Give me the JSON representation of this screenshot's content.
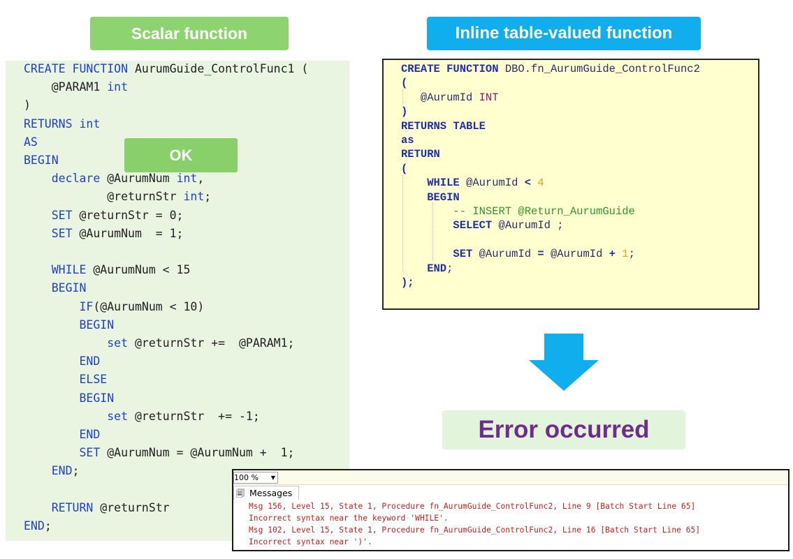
{
  "titles": {
    "scalar": "Scalar function",
    "itvf": "Inline table-valued function",
    "ok": "OK",
    "error": "Error occurred"
  },
  "scalar_code": [
    [
      {
        "t": "CREATE FUNCTION ",
        "c": "kw"
      },
      {
        "t": "AurumGuide_ControlFunc1 (",
        "c": ""
      }
    ],
    [
      {
        "t": "    @PARAM1 ",
        "c": ""
      },
      {
        "t": "int",
        "c": "ty"
      }
    ],
    [
      {
        "t": ")",
        "c": ""
      }
    ],
    [
      {
        "t": "RETURNS ",
        "c": "kw"
      },
      {
        "t": "int",
        "c": "ty"
      }
    ],
    [
      {
        "t": "AS",
        "c": "kw"
      }
    ],
    [
      {
        "t": "BEGIN",
        "c": "kw"
      }
    ],
    [
      {
        "t": "    declare ",
        "c": "kw"
      },
      {
        "t": "@AurumNum ",
        "c": ""
      },
      {
        "t": "int",
        "c": "ty"
      },
      {
        "t": ",",
        "c": ""
      }
    ],
    [
      {
        "t": "            @returnStr ",
        "c": ""
      },
      {
        "t": "int",
        "c": "ty"
      },
      {
        "t": ";",
        "c": ""
      }
    ],
    [
      {
        "t": "    SET ",
        "c": "kw"
      },
      {
        "t": "@returnStr = 0;",
        "c": ""
      }
    ],
    [
      {
        "t": "    SET ",
        "c": "kw"
      },
      {
        "t": "@AurumNum  = 1;",
        "c": ""
      }
    ],
    [
      {
        "t": "",
        "c": ""
      }
    ],
    [
      {
        "t": "    WHILE ",
        "c": "kw"
      },
      {
        "t": "@AurumNum < 15",
        "c": ""
      }
    ],
    [
      {
        "t": "    BEGIN",
        "c": "kw"
      }
    ],
    [
      {
        "t": "        IF",
        "c": "kw"
      },
      {
        "t": "(@AurumNum < 10)",
        "c": ""
      }
    ],
    [
      {
        "t": "        BEGIN",
        "c": "kw"
      }
    ],
    [
      {
        "t": "            set ",
        "c": "kw"
      },
      {
        "t": "@returnStr +=  @PARAM1;",
        "c": ""
      }
    ],
    [
      {
        "t": "        END",
        "c": "kw"
      }
    ],
    [
      {
        "t": "        ELSE",
        "c": "kw"
      }
    ],
    [
      {
        "t": "        BEGIN",
        "c": "kw"
      }
    ],
    [
      {
        "t": "            set ",
        "c": "kw"
      },
      {
        "t": "@returnStr  += -1;",
        "c": ""
      }
    ],
    [
      {
        "t": "        END",
        "c": "kw"
      }
    ],
    [
      {
        "t": "        SET ",
        "c": "kw"
      },
      {
        "t": "@AurumNum = @AurumNum +  1;",
        "c": ""
      }
    ],
    [
      {
        "t": "    END",
        "c": "kw"
      },
      {
        "t": ";",
        "c": ""
      }
    ],
    [
      {
        "t": "",
        "c": ""
      }
    ],
    [
      {
        "t": "    RETURN ",
        "c": "kw"
      },
      {
        "t": "@returnStr",
        "c": ""
      }
    ],
    [
      {
        "t": "END",
        "c": "kw"
      },
      {
        "t": ";",
        "c": ""
      }
    ]
  ],
  "itvf_code": [
    [
      {
        "t": "CREATE FUNCTION ",
        "c": "bk"
      },
      {
        "t": "DBO.fn_AurumGuide_ControlFunc2",
        "c": "nm"
      }
    ],
    [
      {
        "t": "(",
        "c": "bk"
      }
    ],
    [
      {
        "t": "   @AurumId ",
        "c": "nm"
      },
      {
        "t": "INT",
        "c": "pk"
      }
    ],
    [
      {
        "t": ")",
        "c": "bk"
      }
    ],
    [
      {
        "t": "RETURNS TABLE",
        "c": "bk"
      }
    ],
    [
      {
        "t": "as",
        "c": "bk"
      }
    ],
    [
      {
        "t": "RETURN",
        "c": "bk"
      }
    ],
    [
      {
        "t": "(",
        "c": "bk"
      }
    ],
    [
      {
        "t": "    WHILE ",
        "c": "bk"
      },
      {
        "t": "@AurumId ",
        "c": "nm"
      },
      {
        "t": "< ",
        "c": "bk"
      },
      {
        "t": "4",
        "c": "num"
      }
    ],
    [
      {
        "t": "    BEGIN",
        "c": "bk"
      }
    ],
    [
      {
        "t": "        -- INSERT @Return_AurumGuide",
        "c": "cm"
      }
    ],
    [
      {
        "t": "        SELECT ",
        "c": "bk"
      },
      {
        "t": "@AurumId ;",
        "c": "nm"
      }
    ],
    [
      {
        "t": "",
        "c": ""
      }
    ],
    [
      {
        "t": "        SET ",
        "c": "bk"
      },
      {
        "t": "@AurumId ",
        "c": "nm"
      },
      {
        "t": "= ",
        "c": "bk"
      },
      {
        "t": "@AurumId ",
        "c": "nm"
      },
      {
        "t": "+ ",
        "c": "bk"
      },
      {
        "t": "1",
        "c": "num"
      },
      {
        "t": ";",
        "c": "nm"
      }
    ],
    [
      {
        "t": "    END",
        "c": "bk"
      },
      {
        "t": ";",
        "c": "nm"
      }
    ],
    [
      {
        "t": ");",
        "c": "bk"
      }
    ]
  ],
  "messages": {
    "zoom": "100 %",
    "tab_label": "Messages",
    "lines": [
      "Msg 156, Level 15, State 1, Procedure fn_AurumGuide_ControlFunc2, Line 9 [Batch Start Line 65]",
      "Incorrect syntax near the keyword 'WHILE'.",
      "Msg 102, Level 15, State 1, Procedure fn_AurumGuide_ControlFunc2, Line 16 [Batch Start Line 65]",
      "Incorrect syntax near ')'."
    ]
  },
  "colors": {
    "scalar_title_bg": "#8dd36f",
    "itvf_title_bg": "#10aeec",
    "arrow": "#10aeec",
    "error_text": "#6e2d8e",
    "error_msg": "#d11d1d"
  }
}
